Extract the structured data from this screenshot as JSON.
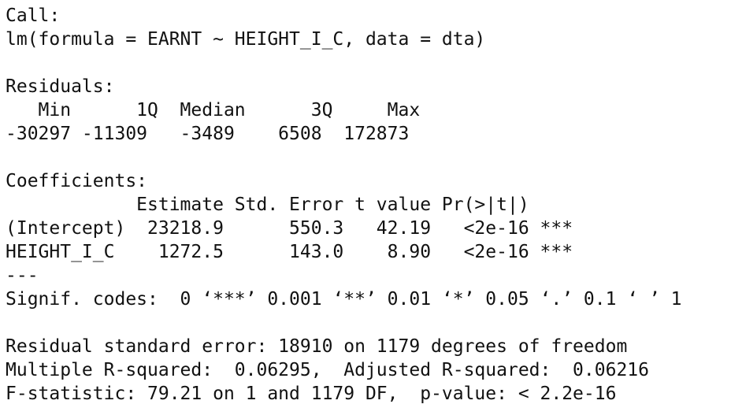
{
  "output": {
    "call_header": "Call:",
    "call": "lm(formula = EARNT ~ HEIGHT_I_C, data = dta)",
    "residuals_header": "Residuals:",
    "residuals_labels": "   Min      1Q  Median      3Q     Max ",
    "residuals_values": "-30297 -11309   -3489    6508  172873 ",
    "coefficients_header": "Coefficients:",
    "coef_columns": "            Estimate Std. Error t value Pr(>|t|)    ",
    "coef_rows": [
      "(Intercept)  23218.9      550.3   42.19   <2e-16 ***",
      "HEIGHT_I_C    1272.5      143.0    8.90   <2e-16 ***"
    ],
    "separator": "---",
    "signif_codes": "Signif. codes:  0 ‘***’ 0.001 ‘**’ 0.01 ‘*’ 0.05 ‘.’ 0.1 ‘ ’ 1",
    "residual_se": "Residual standard error: 18910 on 1179 degrees of freedom",
    "r_squared": "Multiple R-squared:  0.06295,\tAdjusted R-squared:  0.06216 ",
    "f_statistic": "F-statistic: 79.21 on 1 and 1179 DF,  p-value: < 2.2e-16"
  }
}
